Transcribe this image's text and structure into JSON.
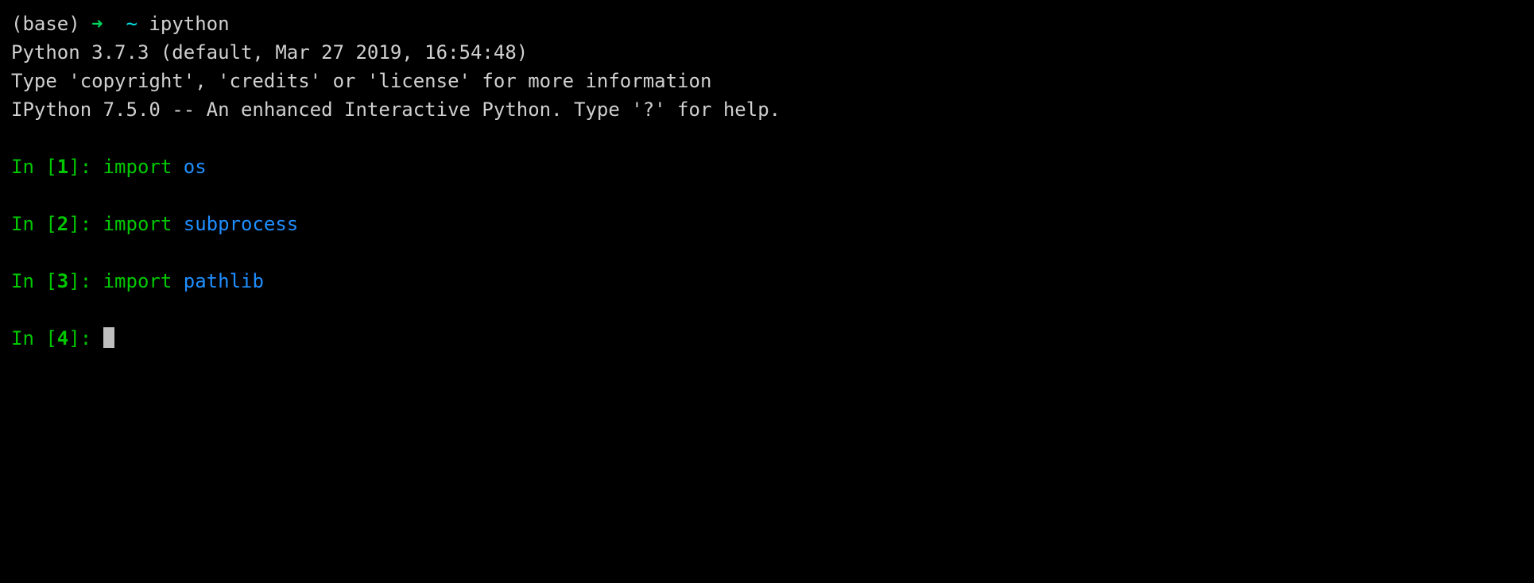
{
  "shell": {
    "env": "(base)",
    "arrow": "➜",
    "cwd": "~",
    "command": "ipython"
  },
  "header": {
    "line1": "Python 3.7.3 (default, Mar 27 2019, 16:54:48)",
    "line2": "Type 'copyright', 'credits' or 'license' for more information",
    "line3": "IPython 7.5.0 -- An enhanced Interactive Python. Type '?' for help."
  },
  "cells": [
    {
      "num": "1",
      "keyword": "import",
      "module": "os"
    },
    {
      "num": "2",
      "keyword": "import",
      "module": "subprocess"
    },
    {
      "num": "3",
      "keyword": "import",
      "module": "pathlib"
    }
  ],
  "current": {
    "num": "4"
  },
  "prompt": {
    "in_prefix": "In [",
    "in_suffix": "]: "
  }
}
